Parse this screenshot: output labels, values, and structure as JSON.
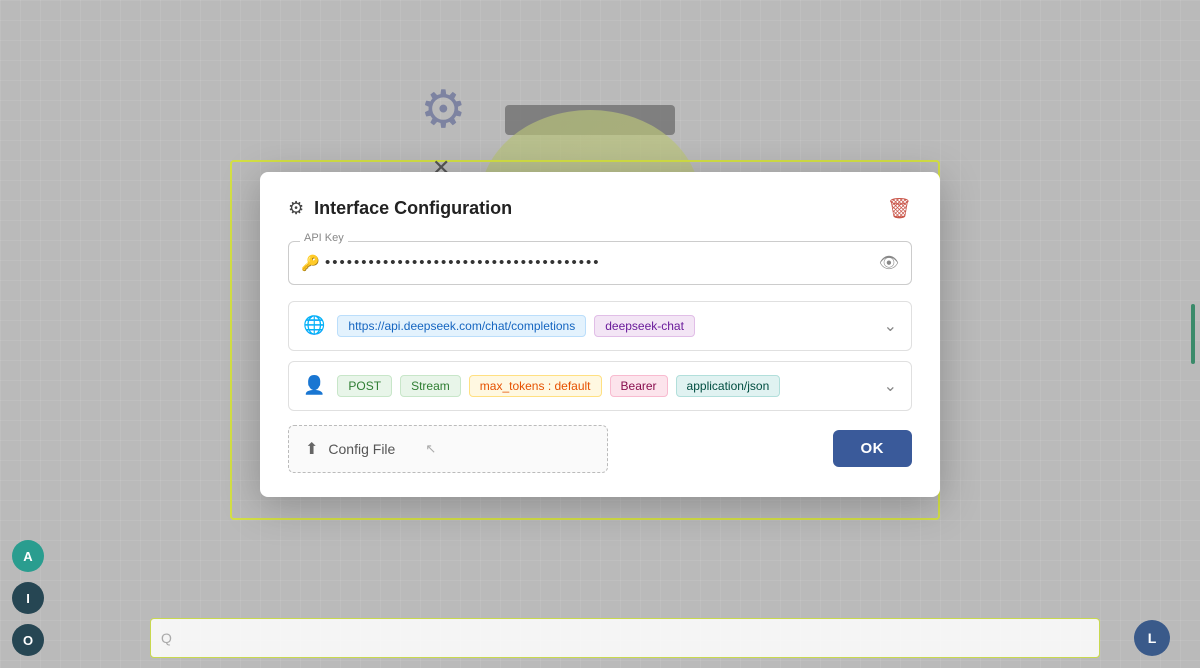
{
  "background": {
    "grid_color": "#c0c0c0"
  },
  "sidebar": {
    "buttons": [
      {
        "label": "A",
        "color": "teal"
      },
      {
        "label": "I",
        "color": "blue"
      },
      {
        "label": "O",
        "color": "dark"
      }
    ]
  },
  "bottom_search": {
    "placeholder": "Q",
    "right_button_label": "L"
  },
  "modal": {
    "title": "Interface Configuration",
    "gear_icon": "⚙",
    "delete_icon": "🗑",
    "api_key_label": "API Key",
    "api_key_value": "••••••••••••••••••••••••••••••••••••••",
    "eye_icon": "👁",
    "key_icon": "🔑",
    "rows": [
      {
        "icon": "🌐",
        "tags": [
          {
            "text": "https://api.deepseek.com/chat/completions",
            "type": "url"
          },
          {
            "text": "deepseek-chat",
            "type": "model"
          }
        ]
      },
      {
        "icon": "👤",
        "tags": [
          {
            "text": "POST",
            "type": "method"
          },
          {
            "text": "Stream",
            "type": "stream"
          },
          {
            "text": "max_tokens : default",
            "type": "tokens"
          },
          {
            "text": "Bearer",
            "type": "bearer"
          },
          {
            "text": "application/json",
            "type": "json"
          }
        ]
      }
    ],
    "config_file_label": "Config File",
    "config_file_icon": "⬆",
    "ok_button": "OK"
  }
}
